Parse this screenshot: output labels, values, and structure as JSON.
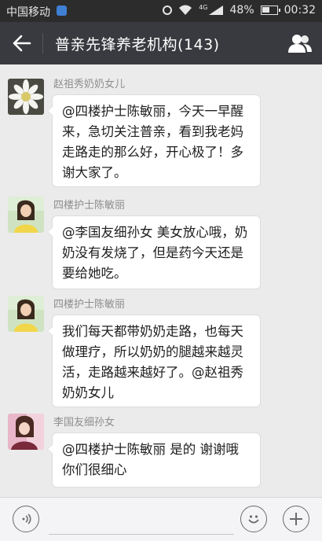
{
  "status_bar": {
    "carrier": "中国移动",
    "network": "4G",
    "battery_percent": "48%",
    "time": "00:32"
  },
  "header": {
    "title": "普亲先锋养老机构(143)"
  },
  "messages": [
    {
      "sender": "赵祖秀奶奶女儿",
      "avatar": "white-flower-avatar",
      "text": "@四楼护士陈敏丽，今天一早醒来，急切关注普亲，看到我老妈走路走的那么好，开心极了！多谢大家了。"
    },
    {
      "sender": "四楼护士陈敏丽",
      "avatar": "woman-yellow-avatar",
      "text": "@李国友细孙女 美女放心哦，奶奶没有发烧了，但是药今天还是要给她吃。"
    },
    {
      "sender": "四楼护士陈敏丽",
      "avatar": "woman-yellow-avatar",
      "text": "我们每天都带奶奶走路，也每天做理疗，所以奶奶的腿越来越灵活，走路越来越好了。@赵祖秀奶奶女儿"
    },
    {
      "sender": "李国友细孙女",
      "avatar": "girl-pink-avatar",
      "text": "@四楼护士陈敏丽 是的 谢谢哦你们很细心"
    }
  ],
  "input_bar": {
    "value": "",
    "voice_icon": "voice-icon",
    "emoji_icon": "emoji-icon",
    "plus_icon": "plus-icon"
  },
  "colors": {
    "status_bar_bg": "#2c2c2c",
    "title_bar_bg": "#393a3f",
    "chat_bg": "#ebebeb",
    "bubble_bg": "#ffffff",
    "sender_text": "#8d8d8d"
  }
}
